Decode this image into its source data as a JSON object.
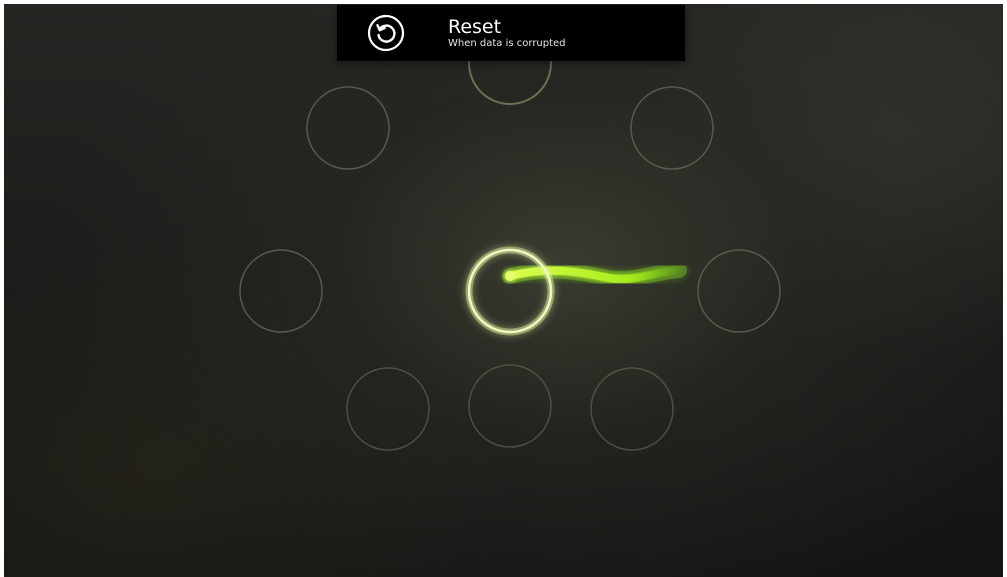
{
  "toast": {
    "title": "Reset",
    "subtitle": "When data is corrupted",
    "icon": "reset-icon"
  },
  "gesture_pad": {
    "targets": [
      "up",
      "up-left",
      "up-right",
      "left",
      "center",
      "right",
      "down-left",
      "down",
      "down-right"
    ],
    "active_target": "center",
    "trail_direction": "right"
  },
  "colors": {
    "toast_background": "#000000",
    "toast_text": "#ffffff",
    "guide_line": "#b9b49a",
    "target_ring": "#6a6b5c",
    "active_ring": "#f1f7c4",
    "trail": "#b6f022",
    "trail_glow": "#7fd41a"
  }
}
